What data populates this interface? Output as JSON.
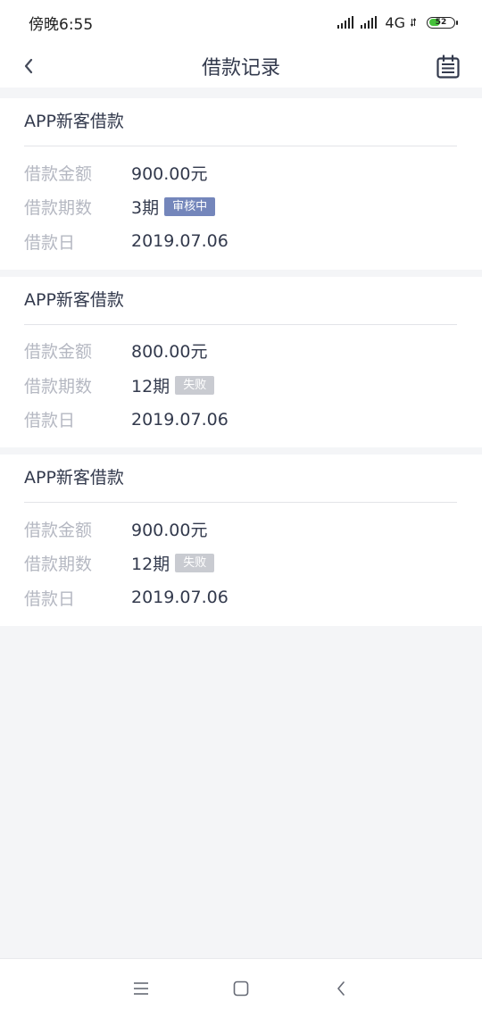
{
  "status_bar": {
    "time": "傍晚6:55",
    "network": "4G",
    "battery": "52",
    "battery_level": 0.52,
    "battery_color": "#45c13a"
  },
  "header": {
    "title": "借款记录",
    "back_icon": "chevron-left-icon",
    "calendar_icon": "calendar-icon"
  },
  "colors": {
    "accent": "#7486bb",
    "muted_badge": "#c9cbd1",
    "label": "#b5b8c2",
    "text": "#333a4d"
  },
  "records": [
    {
      "title": "APP新客借款",
      "amount_label": "借款金额",
      "amount": "900.00元",
      "term_label": "借款期数",
      "term": "3期",
      "status": "审核中",
      "status_color": "#7486bb",
      "date_label": "借款日",
      "date": "2019.07.06"
    },
    {
      "title": "APP新客借款",
      "amount_label": "借款金额",
      "amount": "800.00元",
      "term_label": "借款期数",
      "term": "12期",
      "status": "失败",
      "status_color": "#c9cbd1",
      "date_label": "借款日",
      "date": "2019.07.06"
    },
    {
      "title": "APP新客借款",
      "amount_label": "借款金额",
      "amount": "900.00元",
      "term_label": "借款期数",
      "term": "12期",
      "status": "失败",
      "status_color": "#c9cbd1",
      "date_label": "借款日",
      "date": "2019.07.06"
    }
  ],
  "system_nav": {
    "menu_icon": "menu-icon",
    "home_icon": "home-square-icon",
    "back_icon": "system-back-icon"
  }
}
